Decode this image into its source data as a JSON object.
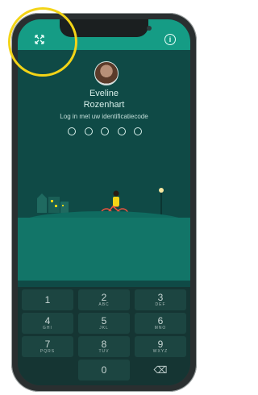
{
  "user": {
    "first_name": "Eveline",
    "last_name": "Rozenhart"
  },
  "login": {
    "prompt": "Log in met uw identificatiecode",
    "pin_length": 5,
    "pin_entered": 0
  },
  "topbar": {
    "expand_icon": "expand-icon",
    "info_icon": "info-icon",
    "info_glyph": "i"
  },
  "keypad": {
    "rows": [
      [
        {
          "d": "1",
          "l": ""
        },
        {
          "d": "2",
          "l": "ABC"
        },
        {
          "d": "3",
          "l": "DEF"
        }
      ],
      [
        {
          "d": "4",
          "l": "GHI"
        },
        {
          "d": "5",
          "l": "JKL"
        },
        {
          "d": "6",
          "l": "MNO"
        }
      ],
      [
        {
          "d": "7",
          "l": "PQRS"
        },
        {
          "d": "8",
          "l": "TUV"
        },
        {
          "d": "9",
          "l": "WXYZ"
        }
      ],
      [
        {
          "d": "",
          "l": ""
        },
        {
          "d": "0",
          "l": ""
        },
        {
          "d": "⌫",
          "l": ""
        }
      ]
    ]
  },
  "colors": {
    "accent": "#159c85",
    "background": "#0f4a46",
    "highlight": "#f3d417"
  }
}
